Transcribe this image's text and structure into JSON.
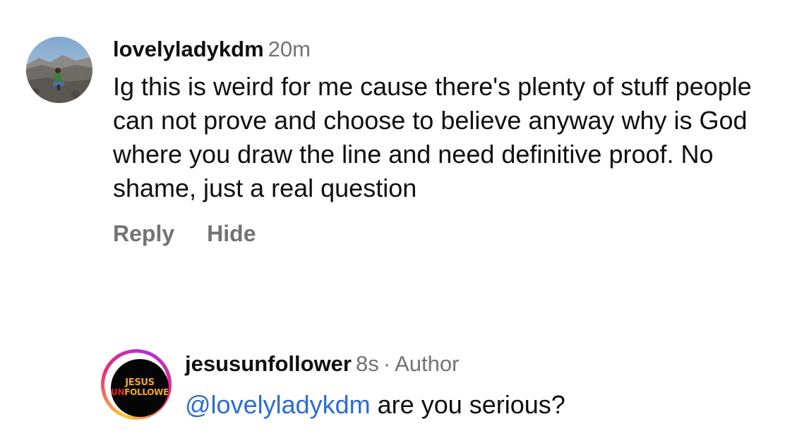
{
  "comments": [
    {
      "username": "lovelyladykdm",
      "time": "20m",
      "text": "Ig this is weird for me cause there's plenty of stuff people can not prove and choose to believe anyway why is God where you draw the line and need definitive proof. No shame, just a real question",
      "actions": {
        "reply": "Reply",
        "hide": "Hide"
      },
      "avatar_icon": "landscape-photo-avatar"
    }
  ],
  "reply": {
    "username": "jesusunfollower",
    "time": "8s",
    "separator": "·",
    "role": "Author",
    "mention": "@lovelyladykdm",
    "text": "are you serious?",
    "avatar": {
      "line1": "JESUS",
      "line2_red": "UN",
      "line2_rest": "FOLLOWER"
    }
  },
  "colors": {
    "text": "#0f0f0f",
    "muted": "#737373",
    "mention": "#2b6cd8",
    "story_ring": [
      "#f9ce34",
      "#ee2a7b",
      "#b130d8"
    ]
  }
}
